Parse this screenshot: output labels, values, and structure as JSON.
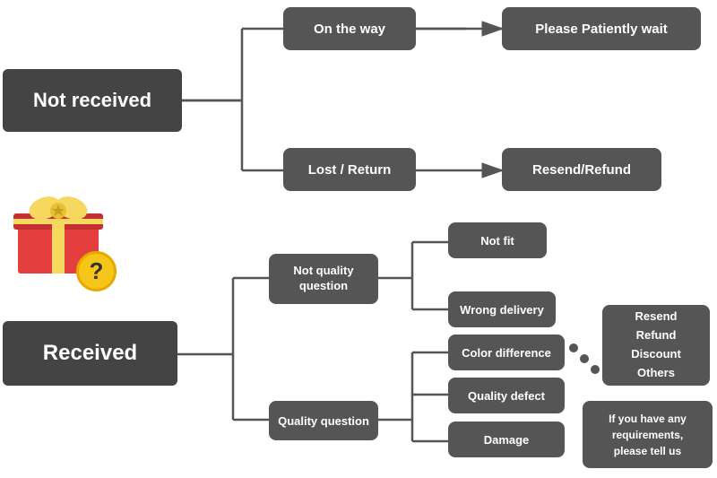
{
  "nodes": {
    "not_received": {
      "label": "Not received"
    },
    "on_the_way": {
      "label": "On the way"
    },
    "please_wait": {
      "label": "Please Patiently wait"
    },
    "lost_return": {
      "label": "Lost / Return"
    },
    "resend_refund_top": {
      "label": "Resend/Refund"
    },
    "received": {
      "label": "Received"
    },
    "not_quality": {
      "label": "Not quality\nquestion"
    },
    "quality_question": {
      "label": "Quality question"
    },
    "not_fit": {
      "label": "Not fit"
    },
    "wrong_delivery": {
      "label": "Wrong delivery"
    },
    "color_difference": {
      "label": "Color difference"
    },
    "quality_defect": {
      "label": "Quality defect"
    },
    "damage": {
      "label": "Damage"
    },
    "resend_refund_bottom": {
      "label": "Resend\nRefund\nDiscount\nOthers"
    },
    "requirements": {
      "label": "If you have any\nrequirements,\nplease tell us"
    }
  },
  "colors": {
    "node_bg": "#555555",
    "large_node_bg": "#444444",
    "text": "#ffffff",
    "arrow": "#555555",
    "question_bg": "#f5c518"
  }
}
